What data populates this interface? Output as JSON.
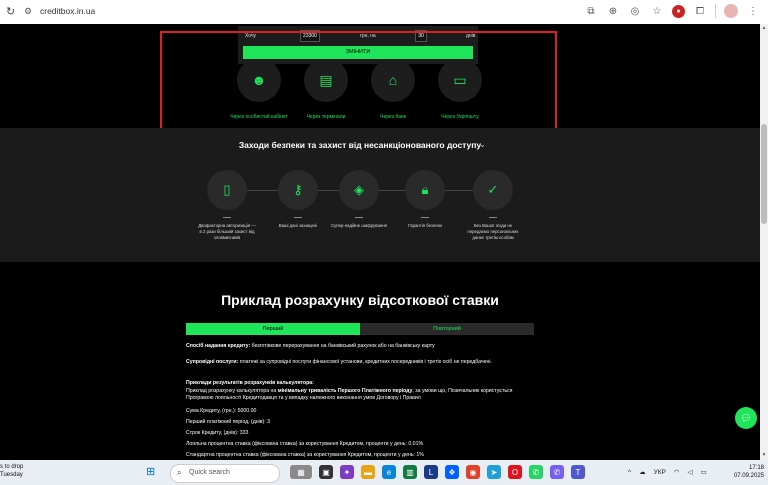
{
  "browser": {
    "url": "creditbox.in.ua"
  },
  "calculator": {
    "want_label": "Хочу",
    "amount": "23300",
    "currency_label": "грн, на",
    "days": "30",
    "days_label": "днів",
    "button_label": "ЗМІНИТИ"
  },
  "methods": [
    {
      "label": "Через особистий кабінет"
    },
    {
      "label": "Через термінали"
    },
    {
      "label": "Через банк"
    },
    {
      "label": "Через Укрпошту"
    }
  ],
  "security": {
    "title": "Заходи безпеки та захист від несанкціонованого доступу",
    "items": [
      {
        "label": "Двофакторна авторизація — в 2 рази більший захист від зловмисників"
      },
      {
        "label": "Ваші дані захищені"
      },
      {
        "label": "Супер-надійне шифрування"
      },
      {
        "label": "Гарантія безпеки"
      },
      {
        "label": "Без Вашої згоди не передаємо персональних даних третім особам"
      }
    ]
  },
  "example": {
    "title": "Приклад розрахунку відсоткової ставки",
    "tab_first": "Перший",
    "tab_repeat": "Повторний",
    "p1_bold": "Спосіб надання кредиту:",
    "p1_text": " безготівкове перерахування на банківський рахунок або на банківську карту",
    "p2_bold": "Супровідні послуги:",
    "p2_text": " платежі за супровідні послуги фінансової установи, кредитних посередників і третіх осіб не передбачені.",
    "p3_bold": "Приклади результатів розрахунків калькулятора:",
    "p3_line1": "Приклад розрахунку калькулятора на ",
    "p3_line1_bold": "мінімальну тривалість Першого Платіжного періоду",
    "p3_line1_end": ", за умови що, Позичальник користується Програмою лояльності Кредитодавця та у випадку належного виконання умов Договору і Правил",
    "line_sum": "Сума Кредиту, (грн.): 5000.00",
    "line_period": "Перший платіжний період, (днів): 3",
    "line_term": "Строк Кредиту, (днів): 333",
    "line_loyal_rate": "Лояльна процентна ставка (фіксована ставка) за користування Кредитом, проценти у день: 0.01%",
    "line_std_rate": "Стандартна процентна ставка (фіксована ставка) за користування Кредитом, проценти у день: 1%"
  },
  "taskbar": {
    "left_line1": "s to drop",
    "left_line2": "Tuesday",
    "search_placeholder": "Quick search",
    "lang": "УКР",
    "time": "17:18",
    "date": "07.09.2025"
  }
}
